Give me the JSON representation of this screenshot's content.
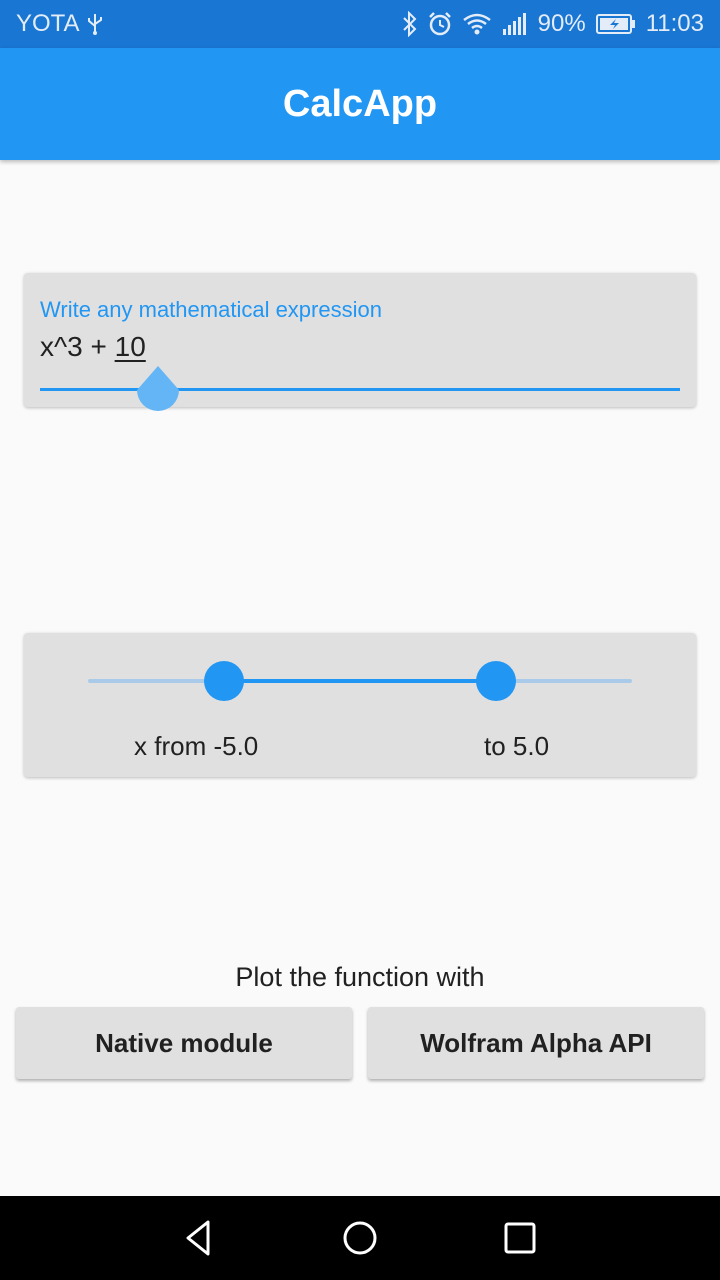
{
  "status_bar": {
    "carrier": "YOTA",
    "battery_percent": "90%",
    "time": "11:03",
    "icons": [
      "usb-icon",
      "bluetooth-icon",
      "alarm-icon",
      "wifi-icon",
      "signal-icon",
      "battery-charging-icon"
    ]
  },
  "app_bar": {
    "title": "CalcApp"
  },
  "expression": {
    "label": "Write any mathematical expression",
    "value_prefix": "x^3 + ",
    "value_underlined": "10"
  },
  "range": {
    "min": -10,
    "max": 10,
    "from_value": -5.0,
    "to_value": 5.0,
    "from_label": "x from -5.0",
    "to_label": "to 5.0"
  },
  "plot": {
    "caption": "Plot the function with",
    "native_button": "Native module",
    "wolfram_button": "Wolfram Alpha API"
  },
  "nav_bar": {
    "icons": [
      "back-icon",
      "home-icon",
      "recents-icon"
    ]
  },
  "colors": {
    "primary": "#2196f3",
    "status_bar": "#1976d2",
    "card": "#e0e0e0"
  }
}
